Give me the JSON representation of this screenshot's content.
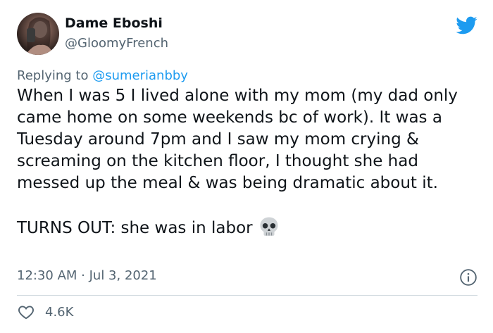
{
  "user": {
    "display_name": "Dame Eboshi",
    "handle": "@GloomyFrench"
  },
  "reply": {
    "prefix": "Replying to ",
    "mention": "@sumerianbby"
  },
  "tweet": {
    "paragraph_1": "When I was 5 I lived alone with my mom (my dad only came home on some weekends bc of work). It was a Tuesday around 7pm and I saw my mom crying & screaming on the kitchen floor, I thought she had messed up the meal & was being dramatic about it.",
    "paragraph_2": "TURNS OUT: she was in labor",
    "timestamp": "12:30 AM · Jul 3, 2021"
  },
  "stats": {
    "likes": "4.6K"
  },
  "icons": {
    "brand": "twitter-bird-icon",
    "emoji": "skull-icon",
    "info": "info-icon",
    "like": "heart-icon"
  },
  "colors": {
    "twitter_blue": "#1d9bf0",
    "secondary_text": "#536471",
    "primary_text": "#0f1419",
    "divider": "#cfd9de"
  }
}
